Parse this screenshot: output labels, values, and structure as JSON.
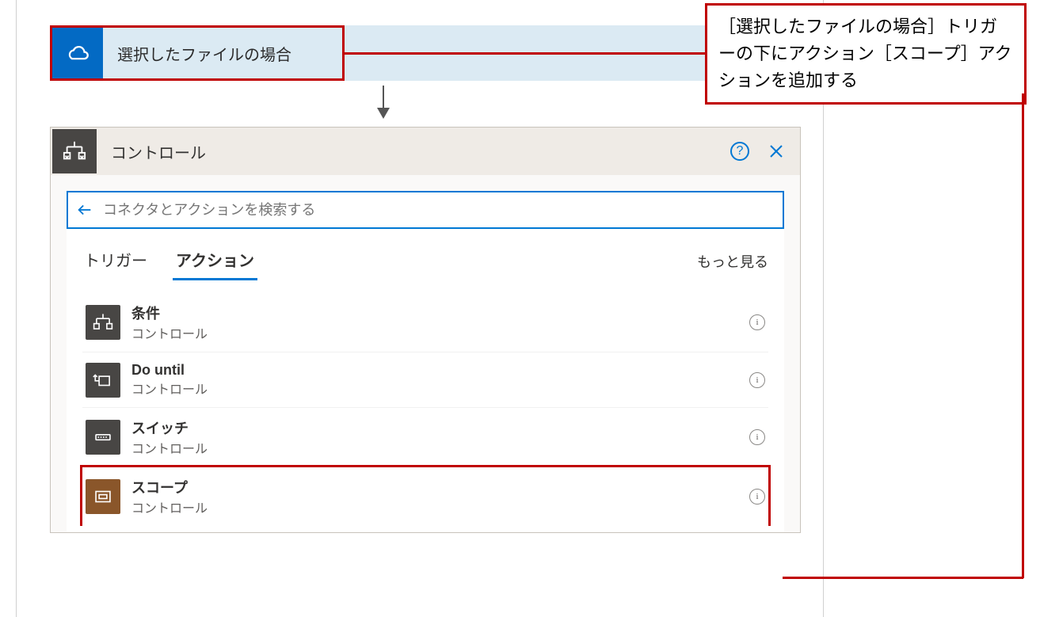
{
  "trigger": {
    "title": "選択したファイルの場合",
    "icon": "onedrive-icon"
  },
  "panel": {
    "title": "コントロール",
    "icon": "control-icon",
    "help_icon": "help-icon",
    "close_icon": "close-icon"
  },
  "search": {
    "placeholder": "コネクタとアクションを検索する",
    "back_icon": "back-arrow-icon"
  },
  "tabs": {
    "trigger_label": "トリガー",
    "action_label": "アクション",
    "more_label": "もっと見る",
    "active": "action"
  },
  "actions": [
    {
      "title": "条件",
      "sub": "コントロール",
      "icon": "condition-icon",
      "bg": "bg-dark",
      "highlight": false
    },
    {
      "title": "Do until",
      "sub": "コントロール",
      "icon": "do-until-icon",
      "bg": "bg-dark",
      "highlight": false
    },
    {
      "title": "スイッチ",
      "sub": "コントロール",
      "icon": "switch-icon",
      "bg": "bg-dark",
      "highlight": false
    },
    {
      "title": "スコープ",
      "sub": "コントロール",
      "icon": "scope-icon",
      "bg": "bg-brown",
      "highlight": true
    }
  ],
  "annotation": {
    "text": "［選択したファイルの場合］トリガーの下にアクション［スコープ］アクションを追加する"
  },
  "info_glyph": "i"
}
